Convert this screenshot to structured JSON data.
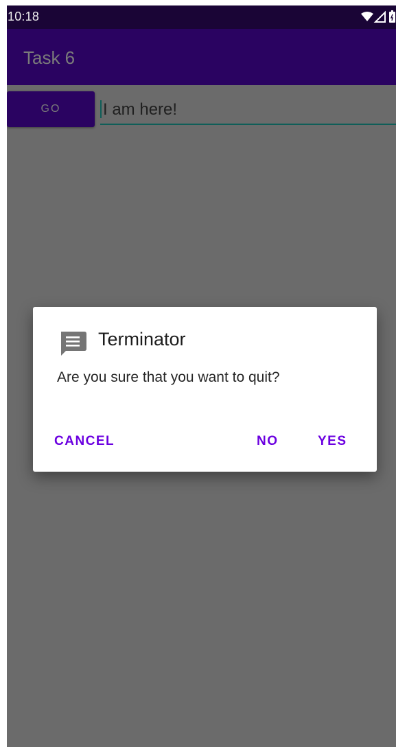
{
  "status_bar": {
    "time": "10:18",
    "icons": [
      "wifi-icon",
      "cell-signal-icon",
      "battery-icon"
    ]
  },
  "app_bar": {
    "title": "Task 6"
  },
  "main": {
    "go_button_label": "GO",
    "text_field_value": "I am here!"
  },
  "dialog": {
    "icon": "message-icon",
    "title": "Terminator",
    "message": "Are you sure that you want to quit?",
    "buttons": {
      "cancel": "CANCEL",
      "no": "NO",
      "yes": "YES"
    }
  },
  "colors": {
    "status_bar_bg": "#1a0536",
    "app_bar_bg": "#2a0361",
    "scrim_bg": "#6b6b6b",
    "accent": "#6b00e0",
    "field_underline": "#0f5e58"
  }
}
